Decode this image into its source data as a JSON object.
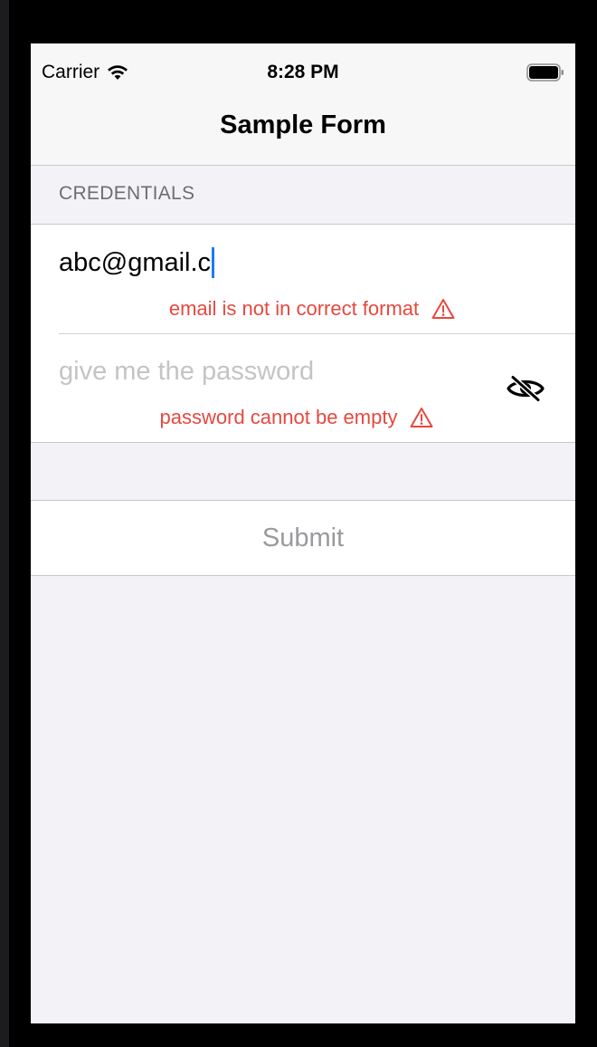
{
  "status_bar": {
    "carrier": "Carrier",
    "time": "8:28 PM",
    "wifi_icon": "wifi-icon",
    "battery_icon": "battery-icon"
  },
  "nav": {
    "title": "Sample Form"
  },
  "form": {
    "section_header": "CREDENTIALS",
    "email": {
      "value": "abc@gmail.c",
      "error": "email is not in correct format",
      "error_icon": "warning-icon"
    },
    "password": {
      "value": "",
      "placeholder": "give me the password",
      "error": "password cannot be empty",
      "error_icon": "warning-icon",
      "toggle_icon": "eye-slash-icon"
    },
    "submit_label": "Submit"
  },
  "colors": {
    "error": "#e5493f",
    "caret": "#1a7cf5",
    "placeholder": "#c4c4c7",
    "disabled_text": "#9a9a9e",
    "group_background": "#f2f2f7"
  }
}
